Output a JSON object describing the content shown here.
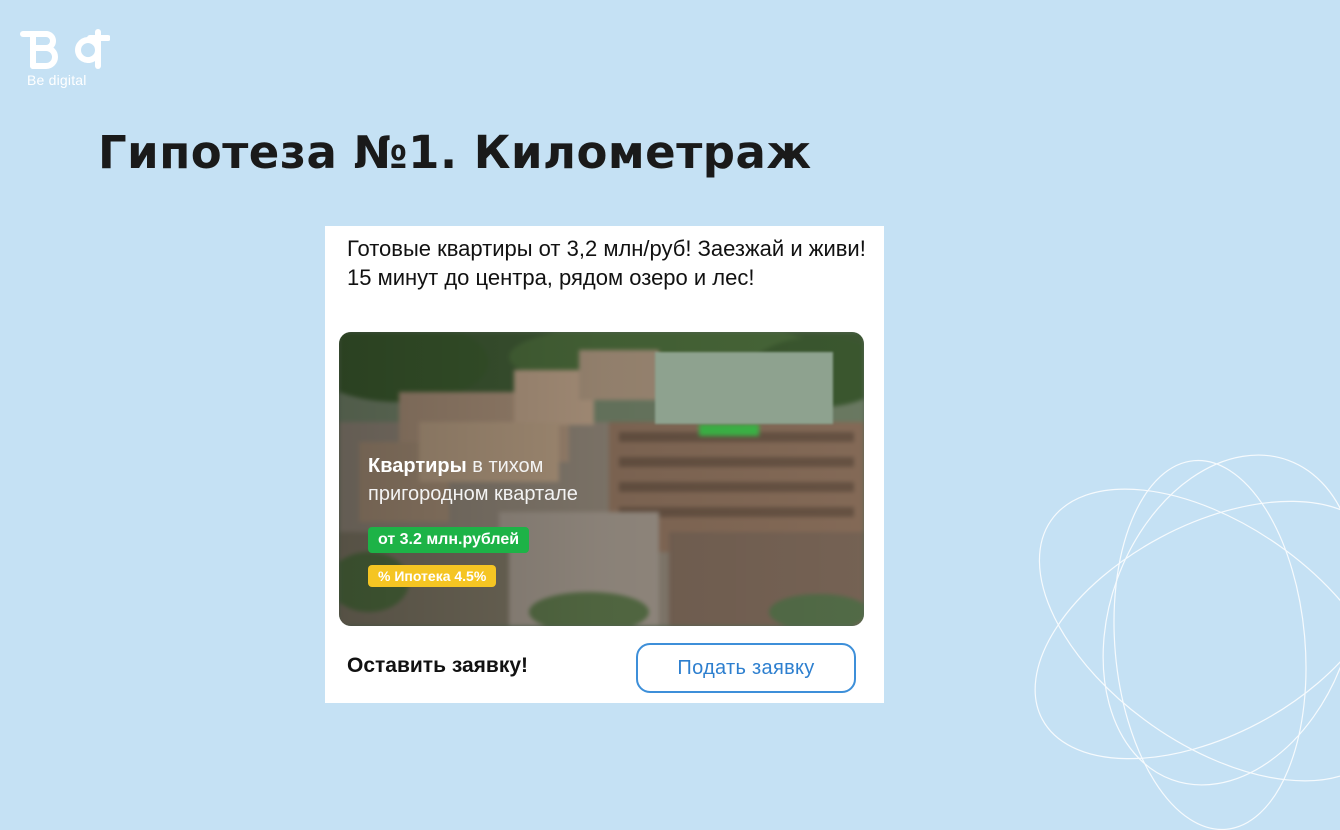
{
  "brand": {
    "name": "Be digital",
    "icon": "bd-logo-icon"
  },
  "slide": {
    "title": "Гипотеза №1. Километраж"
  },
  "ad": {
    "text": "Готовые квартиры от 3,2 млн/руб! Заезжай и живи! 15 минут до центра, рядом озеро и лес!",
    "banner": {
      "headline_bold": "Квартиры",
      "headline_rest": " в тихом пригородном квартале",
      "price_badge": "от 3.2 млн.рублей",
      "mortgage_badge": "% Ипотека 4.5%"
    },
    "cta_text": "Оставить заявку!",
    "cta_button": "Подать заявку"
  },
  "colors": {
    "background": "#c5e1f4",
    "price_badge": "#1db347",
    "mortgage_badge": "#f5c523",
    "button_border": "#3d8fd9"
  }
}
